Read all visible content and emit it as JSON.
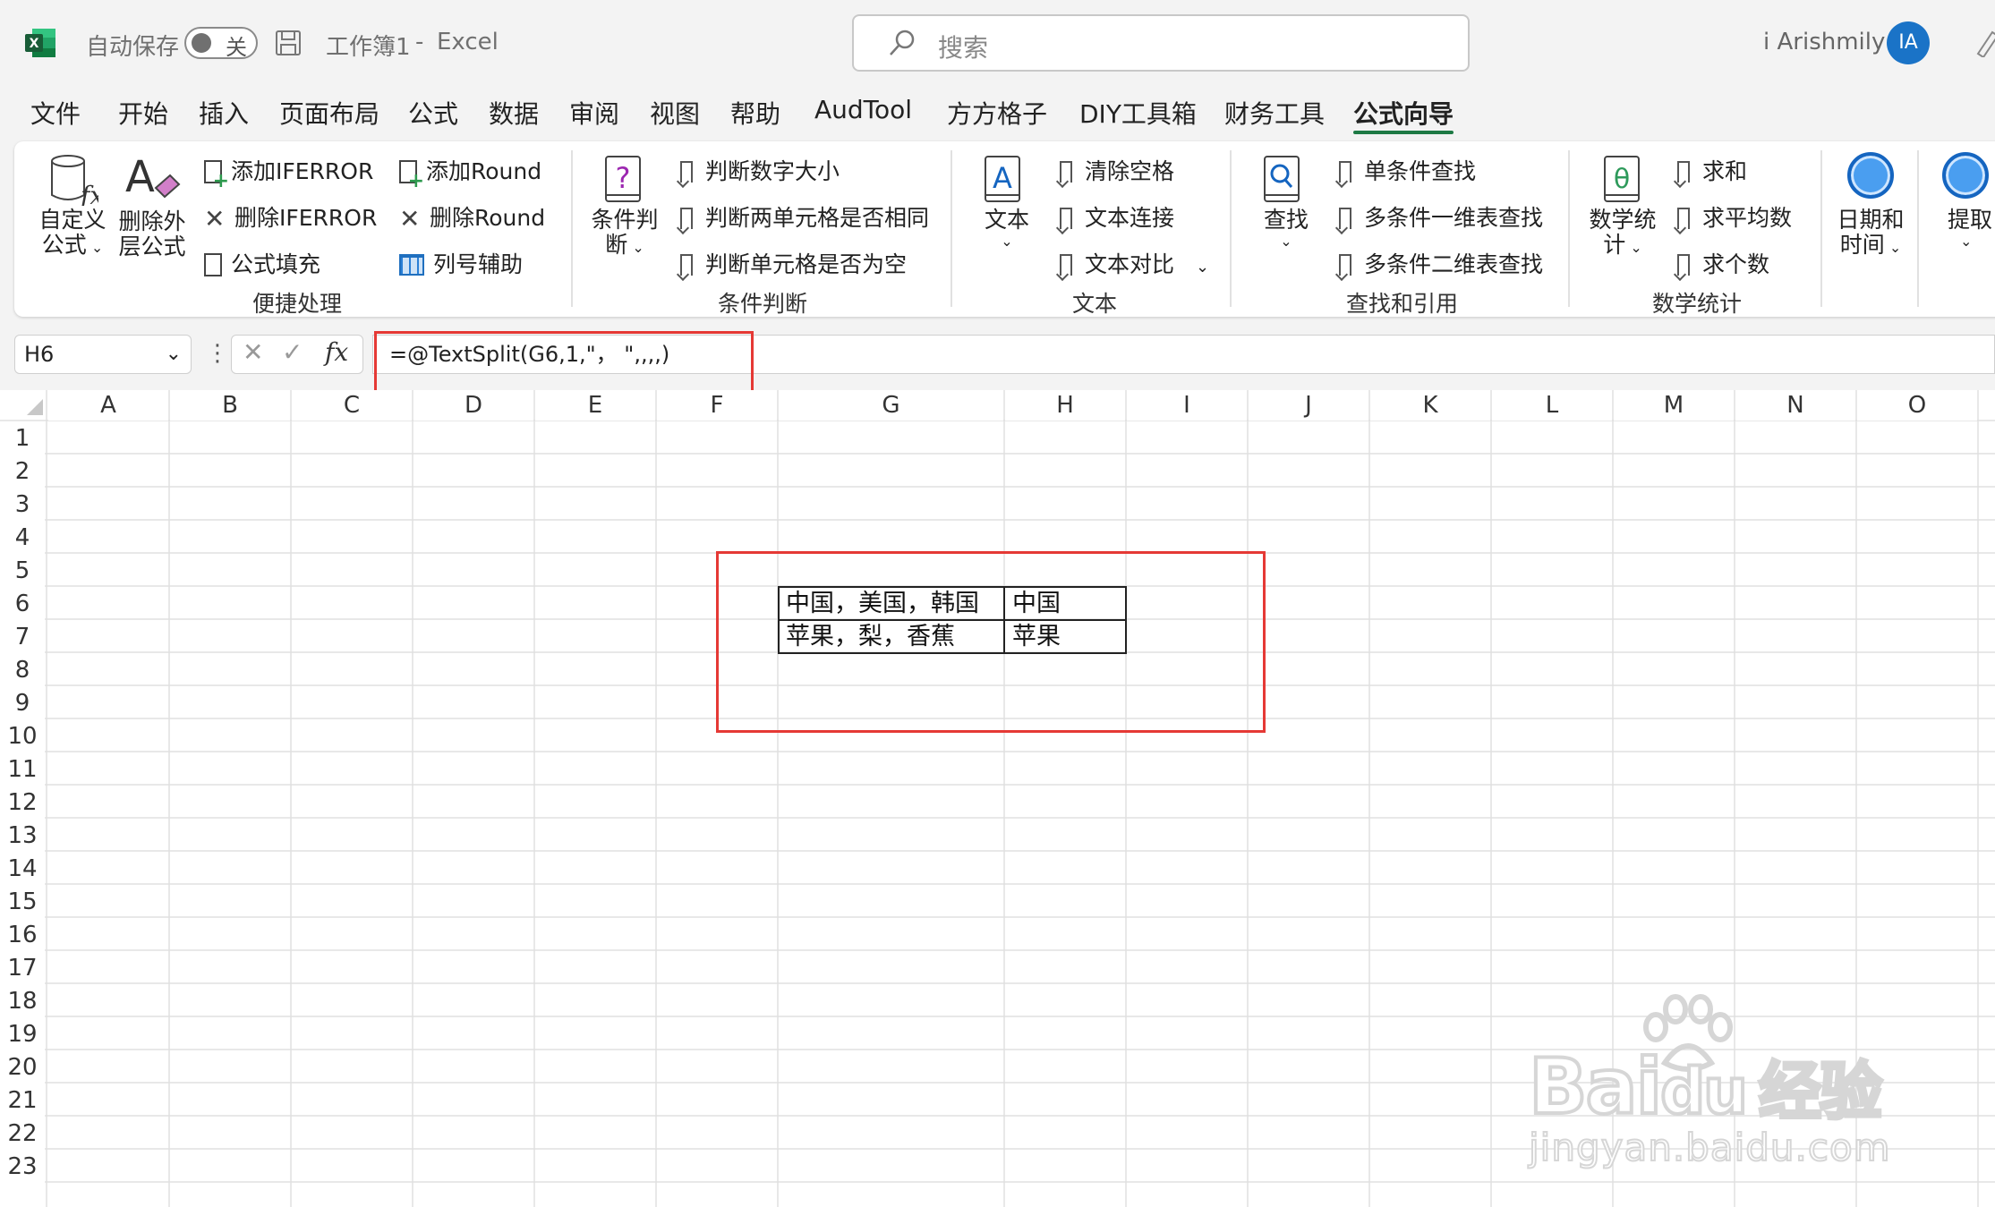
{
  "titlebar": {
    "autosave_label": "自动保存",
    "autosave_state": "关",
    "document_title": "工作簿1",
    "separator": "-",
    "app_name": "Excel",
    "search_placeholder": "搜索",
    "user_name": "i Arishmily",
    "user_initials": "IA"
  },
  "menu": {
    "tabs": [
      "文件",
      "开始",
      "插入",
      "页面布局",
      "公式",
      "数据",
      "审阅",
      "视图",
      "帮助",
      "AudTool",
      "方方格子",
      "DIY工具箱",
      "财务工具",
      "公式向导"
    ],
    "active_tab": "公式向导"
  },
  "ribbon": {
    "group1": {
      "label": "便捷处理",
      "big1": {
        "line1": "自定义",
        "line2": "公式"
      },
      "big2": {
        "line1": "删除外",
        "line2": "层公式"
      },
      "items": [
        "添加IFERROR",
        "删除IFERROR",
        "公式填充",
        "添加Round",
        "删除Round",
        "列号辅助"
      ]
    },
    "group2": {
      "label": "条件判断",
      "big": {
        "line1": "条件判",
        "line2": "断"
      },
      "items": [
        "判断数字大小",
        "判断两单元格是否相同",
        "判断单元格是否为空"
      ]
    },
    "group3": {
      "label": "文本",
      "big": {
        "line1": "文本"
      },
      "items": [
        "清除空格",
        "文本连接",
        "文本对比"
      ]
    },
    "group4": {
      "label": "查找和引用",
      "big": {
        "line1": "查找"
      },
      "items": [
        "单条件查找",
        "多条件一维表查找",
        "多条件二维表查找"
      ]
    },
    "group5": {
      "label": "数学统计",
      "big": {
        "line1": "数学统",
        "line2": "计"
      },
      "items": [
        "求和",
        "求平均数",
        "求个数"
      ]
    },
    "group6": {
      "big": {
        "line1": "日期和",
        "line2": "时间"
      }
    },
    "group7": {
      "big": {
        "line1": "提取"
      }
    }
  },
  "formula_bar": {
    "name_box": "H6",
    "fx_symbol": "fx",
    "formula": "=@TextSplit(G6,1,\"， \",,,,)"
  },
  "columns": [
    "A",
    "B",
    "C",
    "D",
    "E",
    "F",
    "G",
    "H",
    "I",
    "J",
    "K",
    "L",
    "M",
    "N",
    "O"
  ],
  "rows": [
    "1",
    "2",
    "3",
    "4",
    "5",
    "6",
    "7",
    "8",
    "9",
    "10",
    "11",
    "12",
    "13",
    "14",
    "15",
    "16",
    "17",
    "18",
    "19",
    "20",
    "21",
    "22",
    "23"
  ],
  "cells": {
    "G6": "中国，美国，韩国",
    "H6": "中国",
    "G7": "苹果，梨，香蕉",
    "H7": "苹果"
  },
  "watermark": {
    "brand": "Bai",
    "brand2": "du",
    "cn": "经验",
    "url": "jingyan.baidu.com"
  },
  "colors": {
    "excel_green": "#1e7a45",
    "highlight_red": "#e53935",
    "avatar_blue": "#1a73c7"
  }
}
